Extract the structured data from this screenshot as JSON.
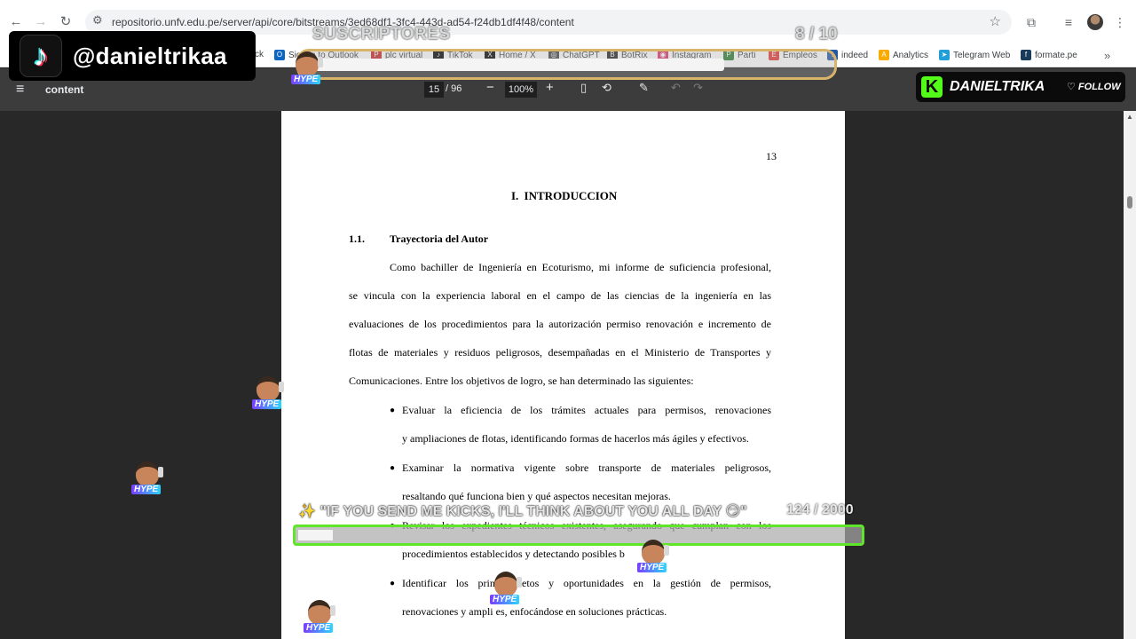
{
  "browser": {
    "url": "repositorio.unfv.edu.pe/server/api/core/bitstreams/3ed68df1-3fc4-443d-ad54-f24db1df4f48/content",
    "bookmarks": [
      {
        "label": "ck"
      },
      {
        "label": "Sign in to Outlook",
        "color": "#0a66c2",
        "glyph": "O"
      },
      {
        "label": "plc virtual",
        "color": "#c62828",
        "glyph": "P"
      },
      {
        "label": "TikTok",
        "color": "#000000",
        "glyph": "♪"
      },
      {
        "label": "Home / X",
        "color": "#000000",
        "glyph": "X"
      },
      {
        "label": "ChatGPT",
        "color": "#444444",
        "glyph": "◎"
      },
      {
        "label": "BotRix",
        "color": "#222222",
        "glyph": "B"
      },
      {
        "label": "Instagram",
        "color": "#e1306c",
        "glyph": "◉"
      },
      {
        "label": "Parti",
        "color": "#2e7d32",
        "glyph": "P"
      },
      {
        "label": "Empleos",
        "color": "#e53935",
        "glyph": "E"
      },
      {
        "label": "indeed",
        "color": "#2557a7",
        "glyph": "i"
      },
      {
        "label": "Analytics",
        "color": "#f9ab00",
        "glyph": "A"
      },
      {
        "label": "Telegram Web",
        "color": "#229ed9",
        "glyph": "➤"
      },
      {
        "label": "formate.pe",
        "color": "#1a3a5c",
        "glyph": "f"
      }
    ]
  },
  "pdf": {
    "title": "content",
    "current_page": "15",
    "total_pages": "/ 96",
    "zoom": "100%"
  },
  "document": {
    "page_number": "13",
    "heading": "I. INTRODUCCION",
    "section_number": "1.1.",
    "section_title": "Trayectoria del Autor",
    "paragraph_lines": [
      "Como bachiller de Ingeniería en Ecoturismo, mi informe de suficiencia profesional,",
      "se vincula con la experiencia laboral en el campo de las ciencias de la ingeniería en las",
      "evaluaciones de los procedimientos para la autorización permiso renovación e incremento de",
      "flotas de materiales y residuos peligrosos, desempañadas en el Ministerio de Transportes y",
      "Comunicaciones. Entre los objetivos de logro, se han determinado las siguientes:"
    ],
    "bullets": [
      {
        "lines": [
          "Evaluar la eficiencia de los trámites actuales para permisos, renovaciones",
          "y ampliaciones de flotas, identificando formas de hacerlos más ágiles y efectivos."
        ]
      },
      {
        "lines": [
          "Examinar la normativa vigente sobre transporte de materiales peligrosos,",
          "resaltando qué funciona bien y qué aspectos necesitan mejoras."
        ]
      },
      {
        "lines": [
          "Revisar los expedientes técnicos existentes, asegurando que cumplan con los",
          "procedimientos establecidos y detectando posibles b"
        ]
      },
      {
        "lines": [
          "Identificar los prin    s retos y oportunidades en la gestión de permisos,",
          "renovaciones y ampli     es, enfocándose en soluciones prácticas."
        ]
      }
    ]
  },
  "overlays": {
    "tiktok_handle": "@danieltrikaa",
    "subs_label": "SUSCRIPTORES",
    "subs_count": "8 / 10",
    "subs_progress": 0.8,
    "kick_name": "DANIELTRIKA",
    "kick_follow": "FOLLOW",
    "kicks_message": "✨ \"IF YOU SEND ME KICKS, I'LL THINK ABOUT YOU ALL DAY 😏\"",
    "kicks_count": "124 / 2000",
    "kicks_progress": 0.062,
    "hype_label": "HYPE"
  }
}
